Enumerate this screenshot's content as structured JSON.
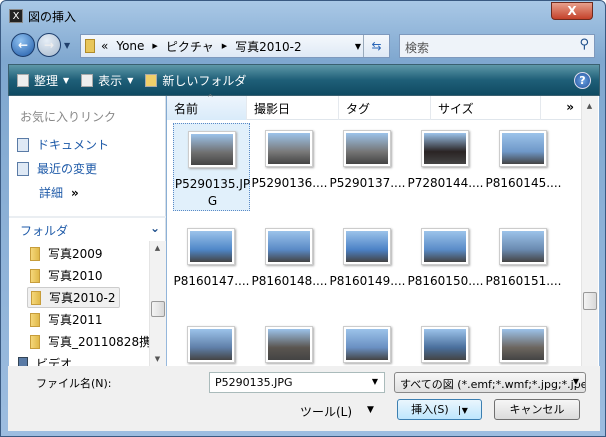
{
  "window": {
    "title": "図の挿入",
    "close": "X"
  },
  "nav": {
    "breadcrumb": [
      "«",
      "Yone",
      "ピクチャ",
      "写真2010-2"
    ],
    "search_placeholder": "検索"
  },
  "toolbar": {
    "organize": "整理",
    "views": "表示",
    "new_folder": "新しいフォルダ",
    "help": "?"
  },
  "left": {
    "favorites_header": "お気に入りリンク",
    "links": [
      "ドキュメント",
      "最近の変更"
    ],
    "more": "詳細",
    "more_glyph": "»",
    "folders_header": "フォルダ",
    "tree": [
      "写真2009",
      "写真2010",
      "写真2010-2",
      "写真2011",
      "写真_20110828携",
      "ビデオ"
    ]
  },
  "columns": [
    "名前",
    "撮影日",
    "タグ",
    "サイズ",
    "»"
  ],
  "files": [
    {
      "name": "P5290135.JPG",
      "color": "#6f6f6f"
    },
    {
      "name": "P5290136....",
      "color": "#7a7a7a"
    },
    {
      "name": "P5290137....",
      "color": "#767676"
    },
    {
      "name": "P7280144....",
      "color": "#2a2424"
    },
    {
      "name": "P8160145....",
      "color": "#6f98c8"
    },
    {
      "name": "P8160147....",
      "color": "#4f87c8"
    },
    {
      "name": "P8160148....",
      "color": "#5a8ac6"
    },
    {
      "name": "P8160149....",
      "color": "#4c82c6"
    },
    {
      "name": "P8160150....",
      "color": "#5a8cc8"
    },
    {
      "name": "P8160151....",
      "color": "#6a8ab0"
    },
    {
      "name": "",
      "color": "#5f7fa8"
    },
    {
      "name": "",
      "color": "#5a5550"
    },
    {
      "name": "",
      "color": "#6a90c2"
    },
    {
      "name": "",
      "color": "#4a6f9c"
    },
    {
      "name": "",
      "color": "#6c665f"
    }
  ],
  "bottom": {
    "filename_label": "ファイル名(N):",
    "filename_value": "P5290135.JPG",
    "filetype": "すべての図 (*.emf;*.wmf;*.jpg;*.jpe",
    "tools": "ツール(L)",
    "insert": "挿入(S)",
    "cancel": "キャンセル"
  }
}
